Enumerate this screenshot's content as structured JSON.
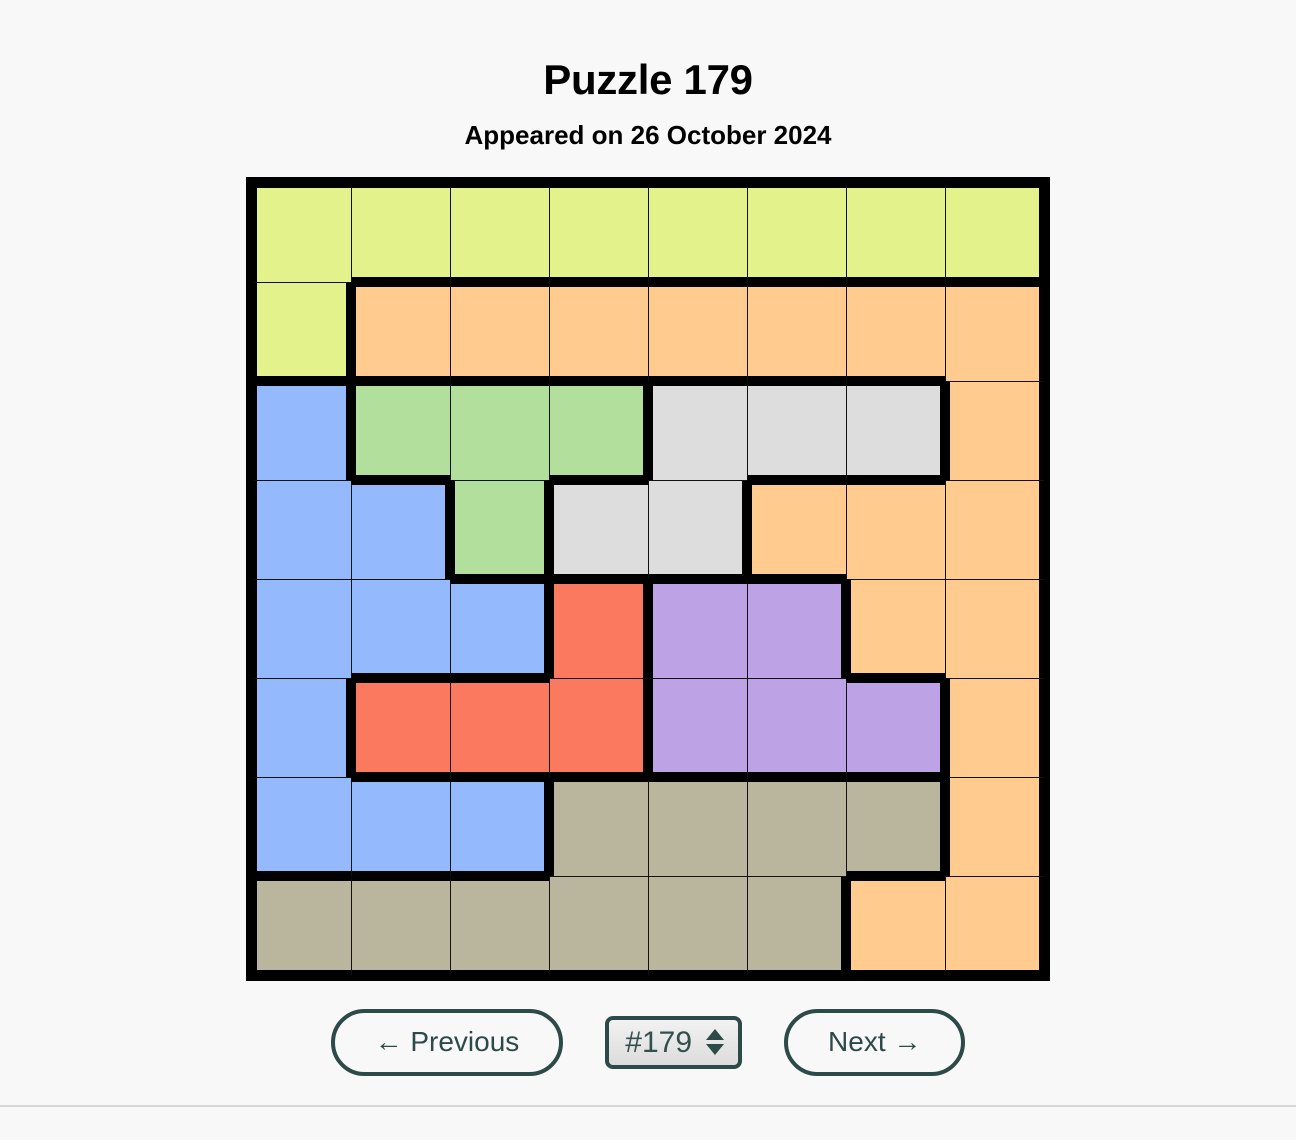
{
  "header": {
    "title": "Puzzle 179",
    "subtitle": "Appeared on 26 October 2024"
  },
  "controls": {
    "previous_label": "← Previous",
    "next_label": "Next →",
    "spinner_value": "#179",
    "spinner_up_icon": "triangle-up-icon",
    "spinner_down_icon": "triangle-down-icon"
  },
  "palette": {
    "Y": "#e4f28c",
    "O": "#ffcb8e",
    "B": "#94bafd",
    "G": "#b2e09c",
    "A": "#dddddd",
    "R": "#fb7a5f",
    "P": "#bda2e6",
    "T": "#bab69e",
    "border": "#000000",
    "page_background": "#f8f8f8",
    "accent": "#2c4a47"
  },
  "chart_data": {
    "type": "heatmap",
    "title": "Puzzle 179",
    "rows": 8,
    "cols": 8,
    "legend_position": "none",
    "grid": true,
    "categories": [
      "Y",
      "O",
      "B",
      "G",
      "A",
      "R",
      "P",
      "T"
    ],
    "region_names": {
      "Y": "yellow-green",
      "O": "orange",
      "B": "blue",
      "G": "green",
      "A": "gray",
      "R": "red",
      "P": "purple",
      "T": "tan"
    },
    "values": [
      [
        "Y",
        "Y",
        "Y",
        "Y",
        "Y",
        "Y",
        "Y",
        "Y"
      ],
      [
        "Y",
        "O",
        "O",
        "O",
        "O",
        "O",
        "O",
        "O"
      ],
      [
        "B",
        "G",
        "G",
        "G",
        "A",
        "A",
        "A",
        "O"
      ],
      [
        "B",
        "B",
        "G",
        "A",
        "A",
        "O",
        "O",
        "O"
      ],
      [
        "B",
        "B",
        "B",
        "R",
        "P",
        "P",
        "O",
        "O"
      ],
      [
        "B",
        "R",
        "R",
        "R",
        "P",
        "P",
        "P",
        "O"
      ],
      [
        "B",
        "B",
        "B",
        "T",
        "T",
        "T",
        "T",
        "O"
      ],
      [
        "T",
        "T",
        "T",
        "T",
        "T",
        "T",
        "O",
        "O"
      ]
    ]
  }
}
